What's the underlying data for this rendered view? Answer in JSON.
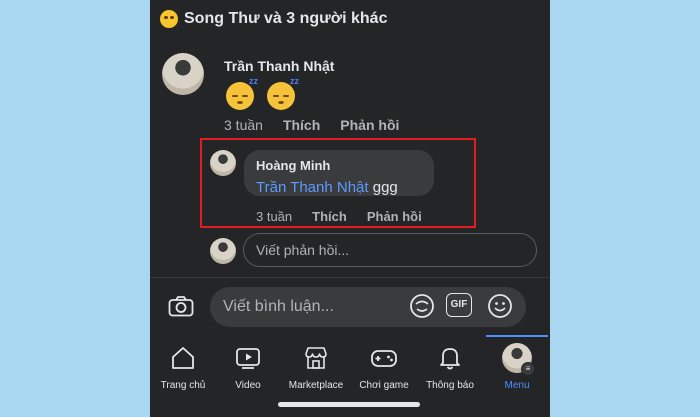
{
  "reactions": {
    "summary": "Song Thư và 3 người khác"
  },
  "comment": {
    "author": "Trần Thanh Nhật",
    "emoji": [
      "sleeping-face",
      "sleeping-face"
    ],
    "time": "3 tuần",
    "like": "Thích",
    "reply": "Phản hồi"
  },
  "reply": {
    "author": "Hoàng Minh",
    "mention": "Trần Thanh Nhật",
    "text": "ggg",
    "time": "3 tuần",
    "like": "Thích",
    "reply": "Phản hồi"
  },
  "reply_input": {
    "placeholder": "Viết phản hồi..."
  },
  "comment_input": {
    "placeholder": "Viết bình luận..."
  },
  "comment_icons": [
    "camera-icon",
    "sticker-icon",
    "gif-icon",
    "emoji-icon"
  ],
  "gif_label": "GIF",
  "nav": [
    {
      "label": "Trang chủ",
      "icon": "home-icon"
    },
    {
      "label": "Video",
      "icon": "video-icon"
    },
    {
      "label": "Marketplace",
      "icon": "store-icon"
    },
    {
      "label": "Chơi game",
      "icon": "gamepad-icon"
    },
    {
      "label": "Thông báo",
      "icon": "bell-icon"
    },
    {
      "label": "Menu",
      "icon": "avatar-menu",
      "active": true
    }
  ],
  "colors": {
    "background": "#242527",
    "accent": "#4a90ff",
    "highlight": "#e41b23",
    "mention": "#5b9bff"
  }
}
